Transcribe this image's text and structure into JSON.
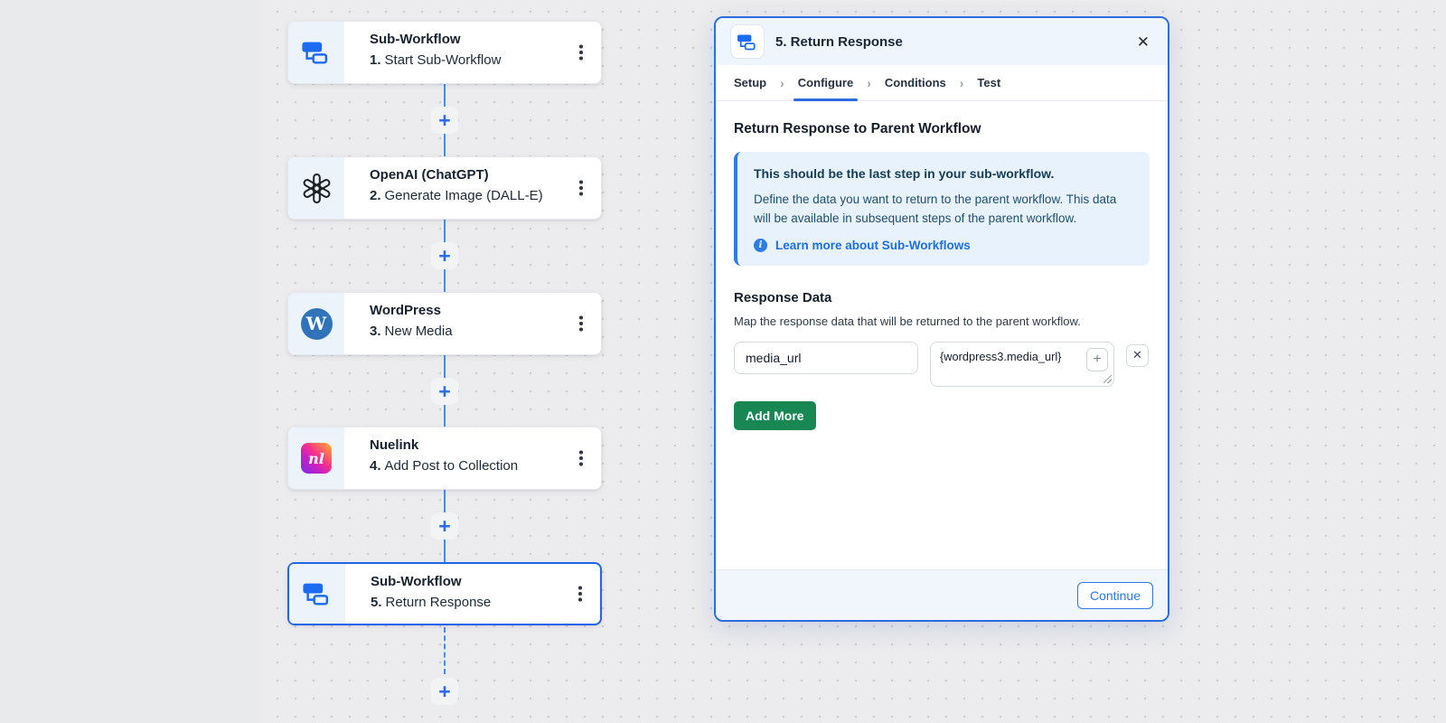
{
  "icons": {
    "plus": "+",
    "close": "✕",
    "chevron": "›",
    "info_i": "i",
    "wordpress_letter": "W",
    "nuelink_letters": "nl"
  },
  "colors": {
    "accent_blue": "#2b6ce0",
    "connector_blue": "#4a8cf7",
    "add_more_green": "#198754",
    "info_box_bg": "#e7f2fd",
    "wordpress_blue": "#3173b9",
    "openai_black": "#1f2328",
    "canvas_bg": "#ececee"
  },
  "canvas": {
    "add_step_symbol": "+",
    "steps": [
      {
        "app": "Sub-Workflow",
        "num": "1.",
        "label": "Start Sub-Workflow",
        "icon": "subworkflow-icon"
      },
      {
        "app": "OpenAI (ChatGPT)",
        "num": "2.",
        "label": "Generate Image (DALL-E)",
        "icon": "openai-icon"
      },
      {
        "app": "WordPress",
        "num": "3.",
        "label": "New Media",
        "icon": "wordpress-icon"
      },
      {
        "app": "Nuelink",
        "num": "4.",
        "label": "Add Post to Collection",
        "icon": "nuelink-icon"
      },
      {
        "app": "Sub-Workflow",
        "num": "5.",
        "label": "Return Response",
        "icon": "subworkflow-icon",
        "selected": true
      }
    ]
  },
  "panel": {
    "title": "5. Return Response",
    "tabs": [
      {
        "label": "Setup"
      },
      {
        "label": "Configure",
        "active": true
      },
      {
        "label": "Conditions"
      },
      {
        "label": "Test"
      }
    ],
    "heading": "Return Response to Parent Workflow",
    "info_box": {
      "title": "This should be the last step in your sub-workflow.",
      "body": "Define the data you want to return to the parent workflow. This data will be available in subsequent steps of the parent workflow.",
      "link": "Learn more about Sub-Workflows"
    },
    "response_data": {
      "heading": "Response Data",
      "description": "Map the response data that will be returned to the parent workflow.",
      "rows": [
        {
          "key": "media_url",
          "value": "{wordpress3.media_url}"
        }
      ],
      "add_more_label": "Add More"
    },
    "continue_label": "Continue"
  }
}
